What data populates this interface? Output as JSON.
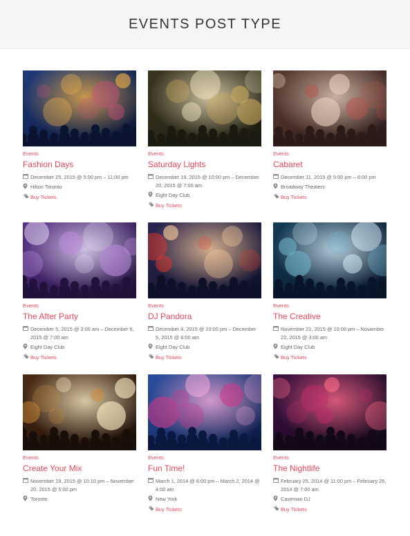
{
  "page": {
    "title": "EVENTS POST TYPE"
  },
  "events": [
    {
      "category": "Events",
      "title": "Fashion Days",
      "date": "December 25, 2015 @ 5:00 pm – 11:00 pm",
      "venue": "Hilton Toronto",
      "tickets": "Buy Tickets",
      "image": {
        "name": "concert-blue-stage-image",
        "colors": [
          "#0a1430",
          "#1d3a7a",
          "#c24f7a",
          "#f2b24c"
        ]
      }
    },
    {
      "category": "Events",
      "title": "Saturday Lights",
      "date": "December 19, 2015 @ 10:00 pm – December 20, 2015 @ 7:00 am",
      "venue": "Eight Day Club",
      "tickets": "Buy Tickets",
      "image": {
        "name": "tree-lights-party-image",
        "colors": [
          "#1b1a10",
          "#3a3520",
          "#c9a85a",
          "#f1e5c0"
        ]
      }
    },
    {
      "category": "Events",
      "title": "Cabaret",
      "date": "December 11, 2015 @ 5:00 pm – 6:00 pm",
      "venue": "Broadway Theaters",
      "tickets": "Buy Tickets",
      "image": {
        "name": "crowd-hall-image",
        "colors": [
          "#2b1b18",
          "#5a3a30",
          "#b8524a",
          "#e8d0c0"
        ]
      }
    },
    {
      "category": "Events",
      "title": "The After Party",
      "date": "December 5, 2015 @ 3:00 am – December 6, 2015 @ 7:00 am",
      "venue": "Eight Day Club",
      "tickets": "Buy Tickets",
      "image": {
        "name": "dj-smoke-image",
        "colors": [
          "#20123a",
          "#5a2f8a",
          "#b78ad8",
          "#f0e8ff"
        ]
      }
    },
    {
      "category": "Events",
      "title": "DJ Pandora",
      "date": "December 4, 2015 @ 10:00 pm – December 5, 2015 @ 6:00 am",
      "venue": "Eight Day Club",
      "tickets": "Buy Tickets",
      "image": {
        "name": "red-lantern-image",
        "colors": [
          "#0e1028",
          "#2a2450",
          "#e83a2a",
          "#ffd0a0"
        ]
      }
    },
    {
      "category": "Events",
      "title": "The Creative",
      "date": "November 21, 2015 @ 10:00 pm – November 22, 2015 @ 3:00 am",
      "venue": "Eight Day Club",
      "tickets": "Buy Tickets",
      "image": {
        "name": "confetti-crowd-image",
        "colors": [
          "#081528",
          "#123a55",
          "#6fb0c8",
          "#e0f4ff"
        ]
      }
    },
    {
      "category": "Events",
      "title": "Create Your Mix",
      "date": "November 19, 2015 @ 10:10 pm – November 20, 2015 @ 5:00 pm",
      "venue": "Toronto",
      "tickets": "",
      "image": {
        "name": "heart-hands-concert-image",
        "colors": [
          "#1a0f08",
          "#4a2a14",
          "#d08a3a",
          "#fff0c8"
        ]
      }
    },
    {
      "category": "Events",
      "title": "Fun Time!",
      "date": "March 1, 2014 @ 6:00 pm – March 2, 2014 @ 4:00 am",
      "venue": "New York",
      "tickets": "Buy Tickets",
      "image": {
        "name": "stage-lights-crowd-image",
        "colors": [
          "#0a1840",
          "#2a4fa0",
          "#c83a8a",
          "#ffb0e0"
        ]
      }
    },
    {
      "category": "Events",
      "title": "The Nightlife",
      "date": "February 25, 2014 @ 11:00 pm – February 26, 2014 @ 7:00 am",
      "venue": "Caveman DJ",
      "tickets": "Buy Tickets",
      "image": {
        "name": "club-purple-lights-image",
        "colors": [
          "#120818",
          "#3a1040",
          "#c02a6a",
          "#ff6a8a"
        ]
      }
    }
  ],
  "icons": {
    "calendar": "calendar-icon",
    "venue": "location-pin-icon",
    "tickets": "ticket-icon"
  },
  "colors": {
    "accent": "#e8475b",
    "header_bg": "#f6f6f6",
    "meta_text": "#666666"
  }
}
